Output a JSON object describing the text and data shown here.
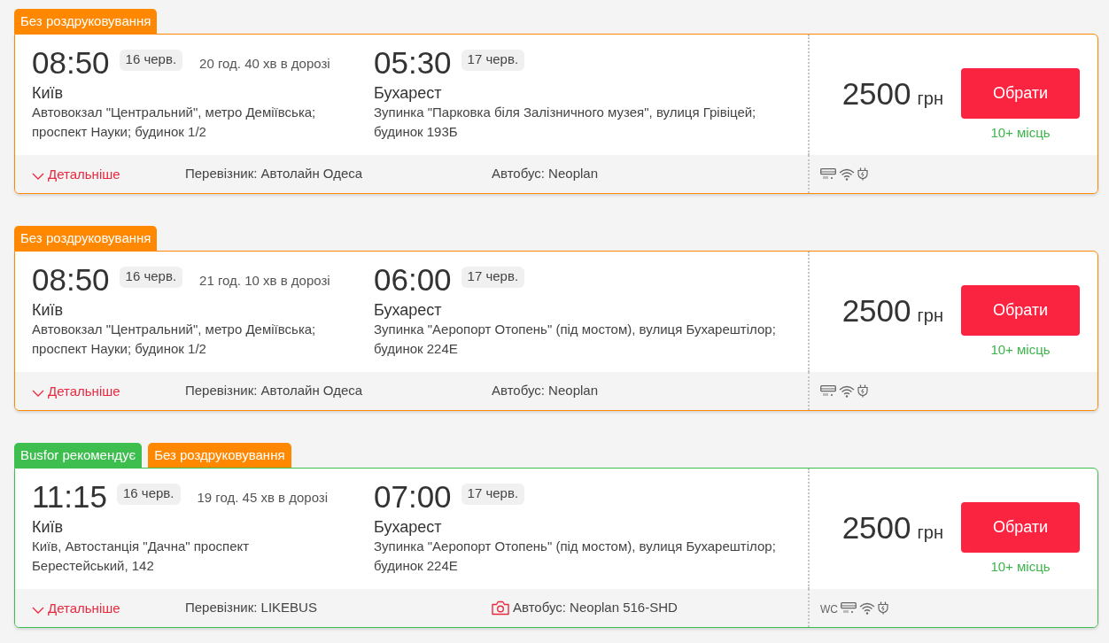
{
  "trips": [
    {
      "badges": [
        {
          "text": "Без роздруковування",
          "color": "#ff8800"
        }
      ],
      "departure": {
        "time": "08:50",
        "date": "16 черв.",
        "city": "Київ",
        "address": "Автовокзал \"Центральний\", метро Деміївська; проспект Науки; будинок 1/2"
      },
      "duration": "20 год. 40 хв в дорозі",
      "arrival": {
        "time": "05:30",
        "date": "17 черв.",
        "city": "Бухарест",
        "address": "Зупинка \"Парковка біля Залізничного музея\", вулиця Грівіцей; будинок 193Б"
      },
      "price": "2500",
      "currency": "грн",
      "button": "Обрати",
      "seats": "10+ місць",
      "details": {
        "label": "Детальніше",
        "expanded": false
      },
      "carrier": "Перевізник: Автолайн Одеса",
      "bus": {
        "text": "Автобус: Neoplan",
        "photo": false
      },
      "amenities": [
        {
          "kind": "air-conditioning"
        },
        {
          "kind": "wifi"
        },
        {
          "kind": "socket"
        }
      ]
    },
    {
      "badges": [
        {
          "text": "Без роздруковування",
          "color": "#ff8800"
        }
      ],
      "departure": {
        "time": "08:50",
        "date": "16 черв.",
        "city": "Київ",
        "address": "Автовокзал \"Центральний\", метро Деміївська; проспект Науки; будинок 1/2"
      },
      "duration": "21 год. 10 хв в дорозі",
      "arrival": {
        "time": "06:00",
        "date": "17 черв.",
        "city": "Бухарест",
        "address": "Зупинка \"Аеропорт Отопень\" (під мостом), вулиця Бухарештілор; будинок 224Е"
      },
      "price": "2500",
      "currency": "грн",
      "button": "Обрати",
      "seats": "10+ місць",
      "details": {
        "label": "Детальніше",
        "expanded": false
      },
      "carrier": "Перевізник: Автолайн Одеса",
      "bus": {
        "text": "Автобус: Neoplan",
        "photo": false
      },
      "amenities": [
        {
          "kind": "air-conditioning"
        },
        {
          "kind": "wifi"
        },
        {
          "kind": "socket"
        }
      ]
    },
    {
      "badges": [
        {
          "text": "Busfor рекомендує",
          "color": "#3dbe4f"
        },
        {
          "text": "Без роздруковування",
          "color": "#ff8800"
        }
      ],
      "departure": {
        "time": "11:15",
        "date": "16 черв.",
        "city": "Київ",
        "address": "Київ, Автостанція \"Дачна\" проспект Берестейський, 142"
      },
      "duration": "19 год. 45 хв в дорозі",
      "arrival": {
        "time": "07:00",
        "date": "17 черв.",
        "city": "Бухарест",
        "address": "Зупинка \"Аеропорт Отопень\" (під мостом), вулиця Бухарештілор; будинок 224Е"
      },
      "price": "2500",
      "currency": "грн",
      "button": "Обрати",
      "seats": "10+ місць",
      "details": {
        "label": "Детальніше",
        "expanded": false
      },
      "carrier": "Перевізник: LIKEBUS",
      "bus": {
        "text": "Автобус: Neoplan 516-SHD",
        "photo": true
      },
      "amenities": [
        {
          "kind": "wc",
          "label": "WC"
        },
        {
          "kind": "air-conditioning"
        },
        {
          "kind": "wifi"
        },
        {
          "kind": "socket"
        }
      ]
    }
  ]
}
